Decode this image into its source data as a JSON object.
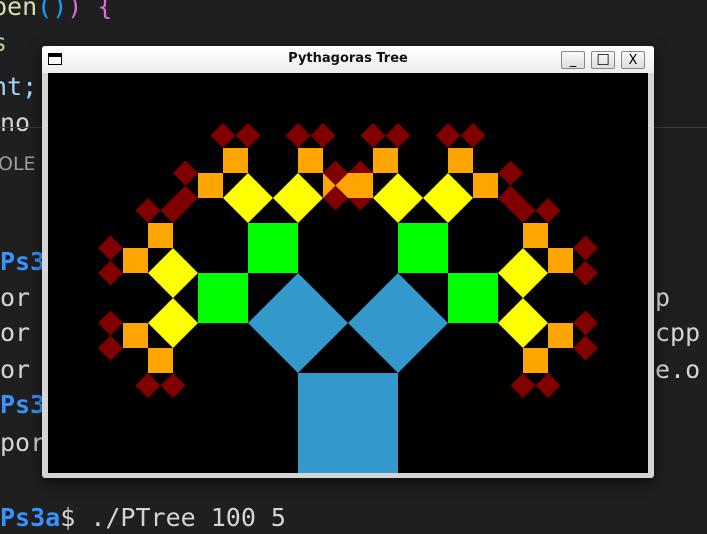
{
  "editor": {
    "line1": {
      "a": "pen",
      "b": "()",
      "c": ")",
      "d": " {"
    },
    "line2": "s",
    "line3": "nt;",
    "line4": "no"
  },
  "panel": {
    "tab_label": "OLE"
  },
  "terminal": {
    "lines": [
      {
        "prompt": "Ps3",
        "text": "",
        "right": ""
      },
      {
        "prompt": "",
        "text": "or",
        "right": "p"
      },
      {
        "prompt": "",
        "text": "or",
        "right": "cpp"
      },
      {
        "prompt": "",
        "text": "or",
        "right": "e.o"
      },
      {
        "prompt": "Ps3",
        "text": "",
        "right": ""
      },
      {
        "prompt": "",
        "text": "por",
        "right": ""
      }
    ],
    "last": {
      "prompt": "Ps3a",
      "text": "$ ./PTree 100 5"
    }
  },
  "window": {
    "title": "Pythagoras Tree",
    "minimize": "_",
    "maximize": "☐",
    "close": "X"
  },
  "tree": {
    "size": 100,
    "depth": 5,
    "angle_deg": 45,
    "level_colors": [
      "#3399cc",
      "#3399cc",
      "#00ff00",
      "#ffff00",
      "#ffa500",
      "#800000"
    ]
  }
}
